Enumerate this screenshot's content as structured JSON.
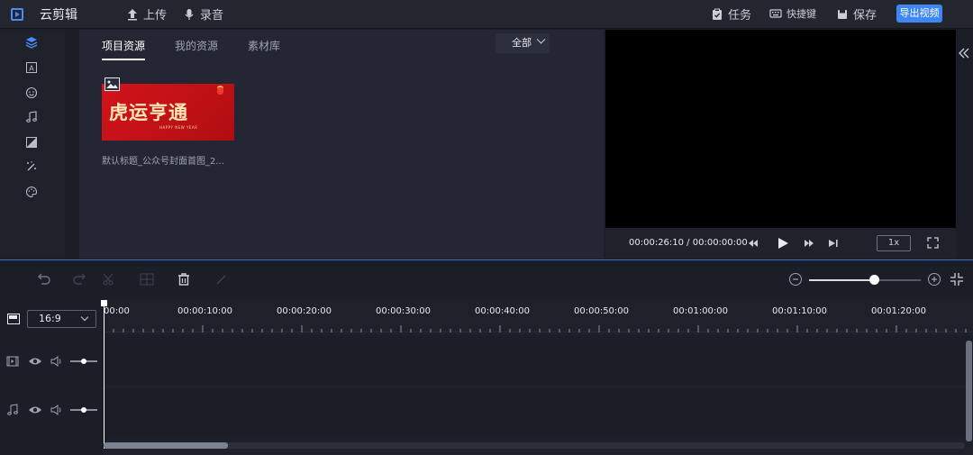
{
  "app": {
    "title": "云剪辑"
  },
  "topbar": {
    "upload_label": "上传",
    "record_label": "录音",
    "tasks_label": "任务",
    "shortcuts_label": "快捷键",
    "save_label": "保存",
    "export_label": "导出视频"
  },
  "rail": {
    "icons": [
      "layers-icon",
      "text-icon",
      "sticker-icon",
      "music-icon",
      "transition-icon",
      "effects-wand-icon",
      "palette-icon"
    ]
  },
  "resources": {
    "tabs": [
      "项目资源",
      "我的资源",
      "素材库"
    ],
    "active_tab": 0,
    "filter": "全部",
    "assets": [
      {
        "thumbnail_text": "虎运亨通",
        "thumbnail_sub": "HAPPY NEW YEAR",
        "caption": "默认标题_公众号封面首图_2..."
      }
    ]
  },
  "preview": {
    "timecode": "00:00:26:10 / 00:00:00:00",
    "speed": "1x"
  },
  "timeline": {
    "aspect_ratio": "16:9",
    "ruler_labels": [
      "00:00",
      "00:00:10:00",
      "00:00:20:00",
      "00:00:30:00",
      "00:00:40:00",
      "00:00:50:00",
      "00:01:00:00",
      "00:01:10:00",
      "00:01:20:00"
    ],
    "zoom_level": 0.58,
    "tracks": [
      {
        "type": "video",
        "icon": "video-track-icon"
      },
      {
        "type": "audio",
        "icon": "audio-track-icon"
      }
    ]
  },
  "colors": {
    "accent": "#3f86f5",
    "background": "#1b1e26"
  }
}
